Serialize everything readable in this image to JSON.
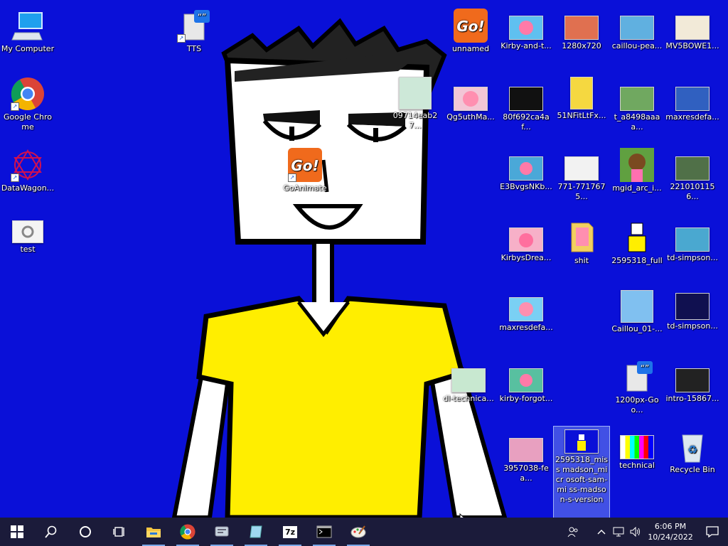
{
  "colors": {
    "desktop_bg": "#0a10d8",
    "taskbar_bg": "#1b1b3a",
    "shirt": "#ffee00",
    "selected": "#a8c8ff"
  },
  "desktop_icons": [
    {
      "label": "My Computer",
      "icon": "computer-icon"
    },
    {
      "label": "Google Chrome",
      "icon": "chrome-icon"
    },
    {
      "label": "DataWagon...",
      "icon": "datawagon-icon"
    },
    {
      "label": "test",
      "icon": "document-icon"
    },
    {
      "label": "TTS",
      "icon": "tts-icon"
    },
    {
      "label": "09714eab27...",
      "icon": "image-thumbnail-icon"
    },
    {
      "label": "GoAnimate",
      "icon": "goanimate-icon"
    },
    {
      "label": "unnamed",
      "icon": "goanimate-icon"
    },
    {
      "label": "Qg5uthMa...",
      "icon": "image-thumbnail-icon"
    },
    {
      "label": "Kirby-and-t...",
      "icon": "image-thumbnail-icon"
    },
    {
      "label": "80f692ca4af...",
      "icon": "image-thumbnail-icon"
    },
    {
      "label": "E3BvgsNKb...",
      "icon": "image-thumbnail-icon"
    },
    {
      "label": "KirbysDrea...",
      "icon": "image-thumbnail-icon"
    },
    {
      "label": "maxresdefa...",
      "icon": "image-thumbnail-icon"
    },
    {
      "label": "kirby-forgot...",
      "icon": "image-thumbnail-icon"
    },
    {
      "label": "3957038-fea...",
      "icon": "image-thumbnail-icon"
    },
    {
      "label": "1280x720",
      "icon": "image-thumbnail-icon"
    },
    {
      "label": "51NFitLtFx...",
      "icon": "image-thumbnail-icon"
    },
    {
      "label": "771-7717675...",
      "icon": "image-thumbnail-icon"
    },
    {
      "label": "shit",
      "icon": "folder-icon"
    },
    {
      "label": "dl-technica...",
      "icon": "image-thumbnail-icon"
    },
    {
      "label": "2595318_miss madson_micr osoft-sam-mi ss-madson-s-version",
      "icon": "image-thumbnail-icon"
    },
    {
      "label": "caillou-pea...",
      "icon": "image-thumbnail-icon"
    },
    {
      "label": "t_a8498aaaa...",
      "icon": "image-thumbnail-icon"
    },
    {
      "label": "mgid_arc_i...",
      "icon": "image-thumbnail-icon"
    },
    {
      "label": "2595318_full",
      "icon": "image-thumbnail-icon"
    },
    {
      "label": "Caillou_01-...",
      "icon": "image-thumbnail-icon"
    },
    {
      "label": "1200px-Goo...",
      "icon": "tts-icon"
    },
    {
      "label": "technical",
      "icon": "image-thumbnail-icon"
    },
    {
      "label": "MV5BOWE1...",
      "icon": "image-thumbnail-icon"
    },
    {
      "label": "maxresdefa...",
      "icon": "image-thumbnail-icon"
    },
    {
      "label": "2210101156...",
      "icon": "image-thumbnail-icon"
    },
    {
      "label": "td-simpson...",
      "icon": "image-thumbnail-icon"
    },
    {
      "label": "td-simpson...",
      "icon": "image-thumbnail-icon"
    },
    {
      "label": "intro-15867...",
      "icon": "image-thumbnail-icon"
    },
    {
      "label": "Recycle Bin",
      "icon": "recycle-bin-icon"
    }
  ],
  "taskbar": {
    "buttons": [
      {
        "name": "start-button",
        "icon": "windows-logo-icon"
      },
      {
        "name": "search-button",
        "icon": "search-icon"
      },
      {
        "name": "cortana-button",
        "icon": "cortana-icon"
      },
      {
        "name": "task-view-button",
        "icon": "task-view-icon"
      },
      {
        "name": "file-explorer-button",
        "icon": "folder-icon"
      },
      {
        "name": "chrome-taskbar-button",
        "icon": "chrome-icon"
      },
      {
        "name": "app-taskbar-button-1",
        "icon": "speech-icon"
      },
      {
        "name": "app-taskbar-button-2",
        "icon": "notepad-icon"
      },
      {
        "name": "7zip-taskbar-button",
        "icon": "7zip-icon"
      },
      {
        "name": "cmd-taskbar-button",
        "icon": "terminal-icon"
      },
      {
        "name": "paint-taskbar-button",
        "icon": "paint-icon"
      }
    ],
    "seven_zip_label": "7z",
    "tray": {
      "time": "6:06 PM",
      "date": "10/24/2022"
    }
  }
}
